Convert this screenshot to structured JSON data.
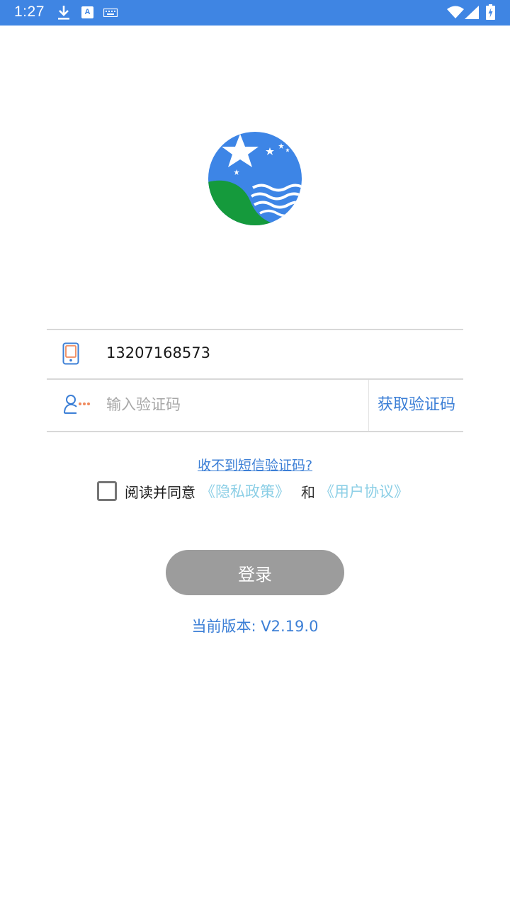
{
  "status_bar": {
    "time": "1:27",
    "background": "#3f85e3",
    "icons": [
      "download-icon",
      "text-a-icon",
      "keyboard-icon",
      "wifi-icon",
      "signal-icon",
      "battery-charging-icon"
    ],
    "a_glyph": "A"
  },
  "logo": {
    "icon": "app-logo",
    "colors": {
      "sky": "#3d85e6",
      "hill": "#159a3c",
      "wave": "#ffffff"
    }
  },
  "form": {
    "phone_icon": "phone-icon",
    "phone_value": "13207168573",
    "code_icon": "user-code-icon",
    "code_placeholder": "输入验证码",
    "get_code_label": "获取验证码"
  },
  "no_sms_link": "收不到短信验证码?",
  "agreement": {
    "checked": false,
    "prefix": "阅读并同意",
    "privacy_label": "《隐私政策》",
    "and_text": "和",
    "terms_label": "《用户协议》"
  },
  "login_button": "登录",
  "version": "当前版本: V2.19.0",
  "colors": {
    "accent": "#3c7fd6",
    "link_light": "#8ccfe6",
    "button_disabled": "#9c9c9c"
  }
}
